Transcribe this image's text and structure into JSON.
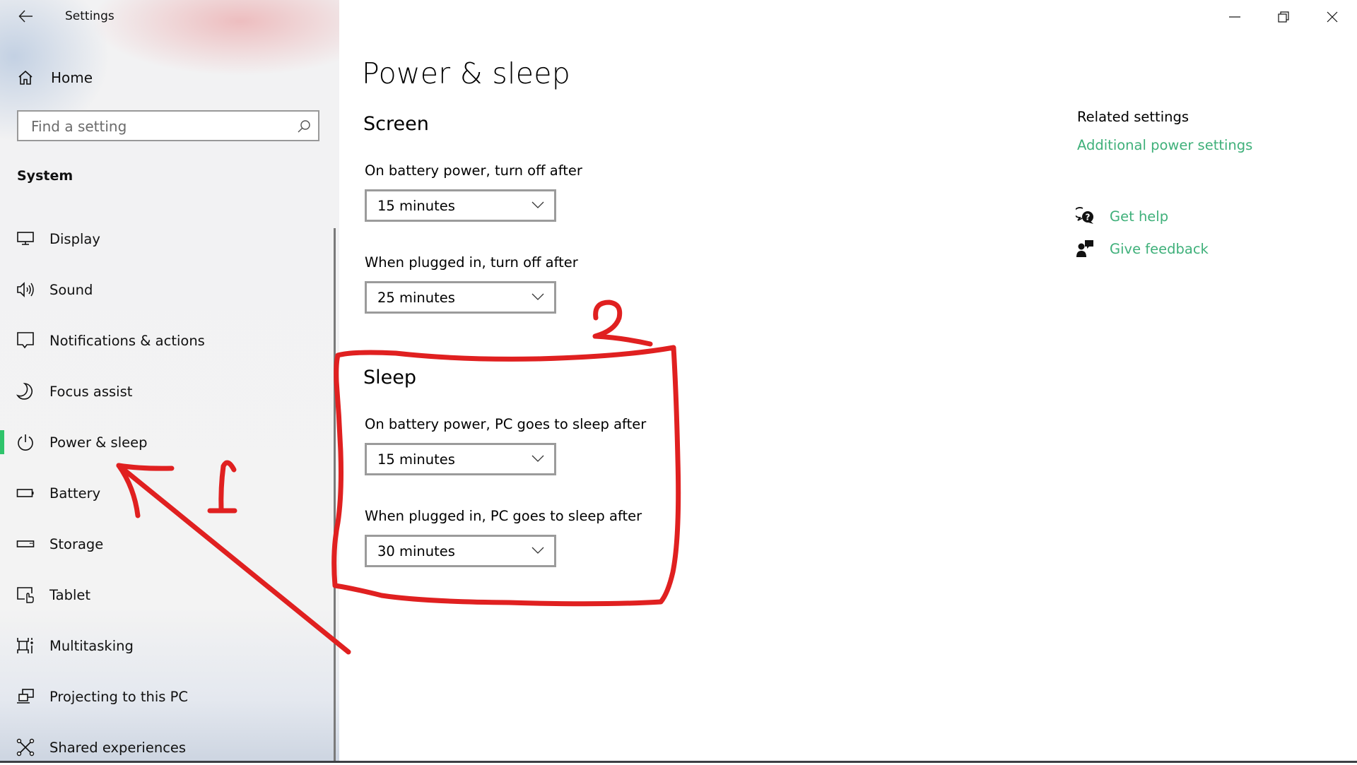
{
  "window": {
    "title": "Settings",
    "controls": {
      "minimize": "minimize-icon",
      "restore": "restore-icon",
      "close": "close-icon"
    }
  },
  "sidebar": {
    "back_icon": "back-arrow-icon",
    "home": {
      "label": "Home",
      "icon": "home-icon"
    },
    "search": {
      "placeholder": "Find a setting",
      "value": "",
      "icon": "search-icon"
    },
    "section_title": "System",
    "items": [
      {
        "label": "Display",
        "icon": "display-icon",
        "selected": false
      },
      {
        "label": "Sound",
        "icon": "sound-icon",
        "selected": false
      },
      {
        "label": "Notifications & actions",
        "icon": "notifications-icon",
        "selected": false
      },
      {
        "label": "Focus assist",
        "icon": "moon-icon",
        "selected": false
      },
      {
        "label": "Power & sleep",
        "icon": "power-icon",
        "selected": true
      },
      {
        "label": "Battery",
        "icon": "battery-icon",
        "selected": false
      },
      {
        "label": "Storage",
        "icon": "storage-icon",
        "selected": false
      },
      {
        "label": "Tablet",
        "icon": "tablet-icon",
        "selected": false
      },
      {
        "label": "Multitasking",
        "icon": "multitasking-icon",
        "selected": false
      },
      {
        "label": "Projecting to this PC",
        "icon": "projecting-icon",
        "selected": false
      },
      {
        "label": "Shared experiences",
        "icon": "shared-experiences-icon",
        "selected": false
      }
    ]
  },
  "main": {
    "title": "Power & sleep",
    "screen": {
      "heading": "Screen",
      "battery_label": "On battery power, turn off after",
      "battery_value": "15 minutes",
      "plugged_label": "When plugged in, turn off after",
      "plugged_value": "25 minutes"
    },
    "sleep": {
      "heading": "Sleep",
      "battery_label": "On battery power, PC goes to sleep after",
      "battery_value": "15 minutes",
      "plugged_label": "When plugged in, PC goes to sleep after",
      "plugged_value": "30 minutes"
    }
  },
  "related": {
    "title": "Related settings",
    "additional_power": "Additional power settings",
    "get_help": "Get help",
    "give_feedback": "Give feedback"
  },
  "annotations": {
    "step1_label": "1",
    "step2_label": "2",
    "color": "#e02020"
  },
  "colors": {
    "accent": "#2fc46b",
    "link": "#3fb07a"
  }
}
